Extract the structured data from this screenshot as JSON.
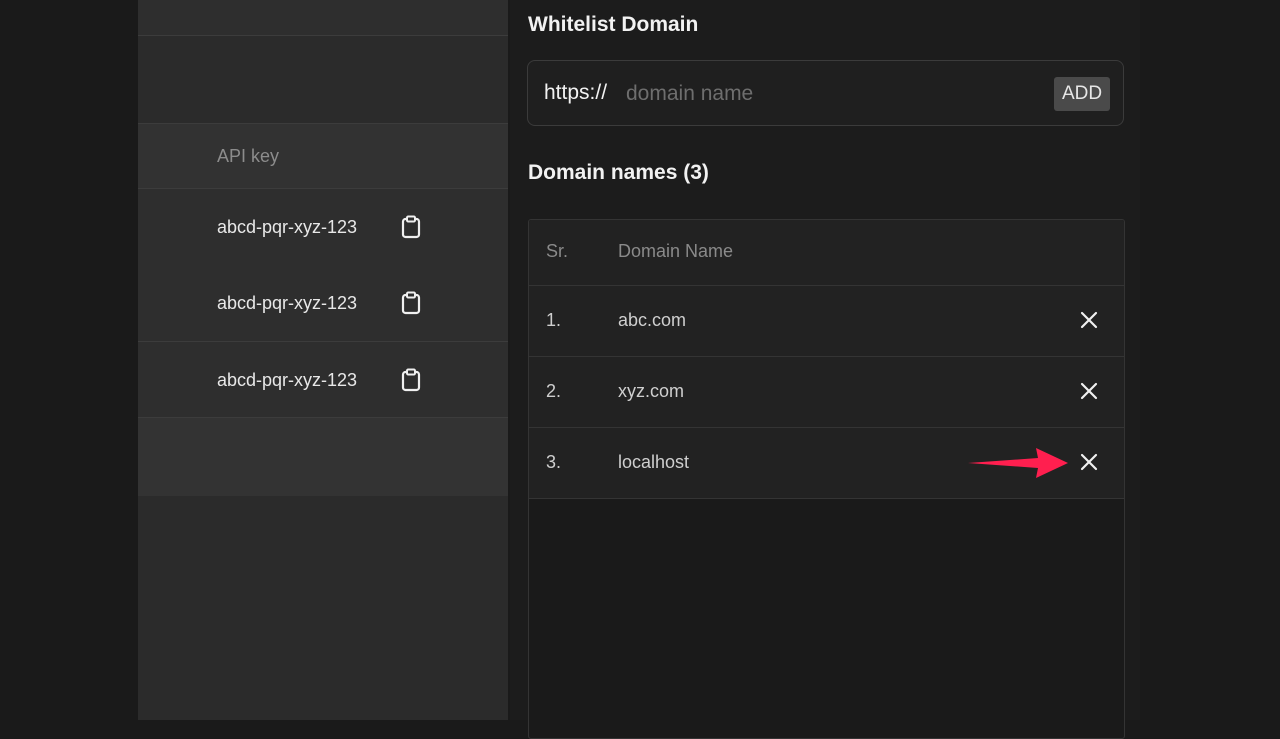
{
  "api_keys": {
    "column_header": "API key",
    "keys": [
      "abcd-pqr-xyz-123",
      "abcd-pqr-xyz-123",
      "abcd-pqr-xyz-123"
    ],
    "copy_icon": "clipboard-icon"
  },
  "whitelist": {
    "title": "Whitelist Domain",
    "prefix": "https://",
    "placeholder": "domain name",
    "add_label": "ADD"
  },
  "domains": {
    "title": "Domain names (3)",
    "headers": {
      "sr": "Sr.",
      "name": "Domain Name"
    },
    "rows": [
      {
        "sr": "1.",
        "name": "abc.com"
      },
      {
        "sr": "2.",
        "name": "xyz.com"
      },
      {
        "sr": "3.",
        "name": "localhost"
      }
    ],
    "delete_icon": "close-icon"
  },
  "colors": {
    "annotation_arrow": "#ff1f4f",
    "background": "#1a1a1a",
    "panel": "#2b2b2b"
  }
}
